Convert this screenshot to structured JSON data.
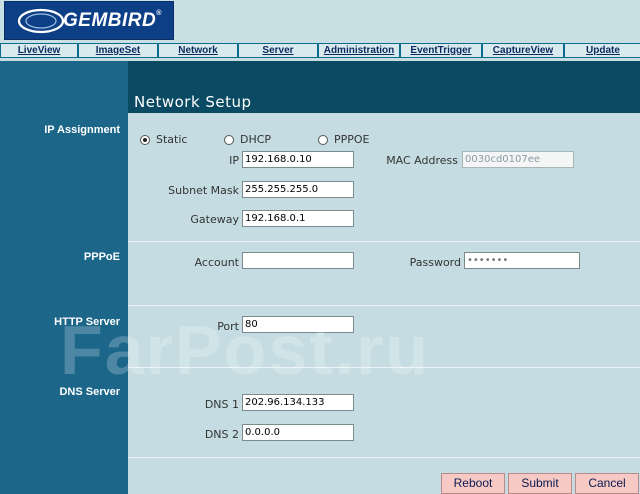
{
  "brand": {
    "logo_text": "GEMBIRD",
    "logo_reg": "®"
  },
  "nav": {
    "items": [
      "LiveView",
      "ImageSet",
      "Network",
      "Server",
      "Administration",
      "EventTrigger",
      "CaptureView",
      "Update"
    ]
  },
  "page_title": "Network Setup",
  "sections": {
    "ip_assignment": "IP Assignment",
    "pppoe": "PPPoE",
    "http_server": "HTTP Server",
    "dns_server": "DNS Server"
  },
  "ip_mode": {
    "static": "Static",
    "dhcp": "DHCP",
    "pppoe": "PPPOE",
    "selected": "Static"
  },
  "fields": {
    "ip_label": "IP",
    "ip": "192.168.0.10",
    "mac_label": "MAC Address",
    "mac": "0030cd0107ee",
    "subnet_label": "Subnet Mask",
    "subnet": "255.255.255.0",
    "gateway_label": "Gateway",
    "gateway": "192.168.0.1",
    "account_label": "Account",
    "account": "",
    "password_label": "Password",
    "password": "•••••••",
    "port_label": "Port",
    "port": "80",
    "dns1_label": "DNS 1",
    "dns1": "202.96.134.133",
    "dns2_label": "DNS 2",
    "dns2": "0.0.0.0"
  },
  "buttons": {
    "reboot": "Reboot",
    "submit": "Submit",
    "cancel": "Cancel"
  },
  "watermark": "FarPost.ru"
}
